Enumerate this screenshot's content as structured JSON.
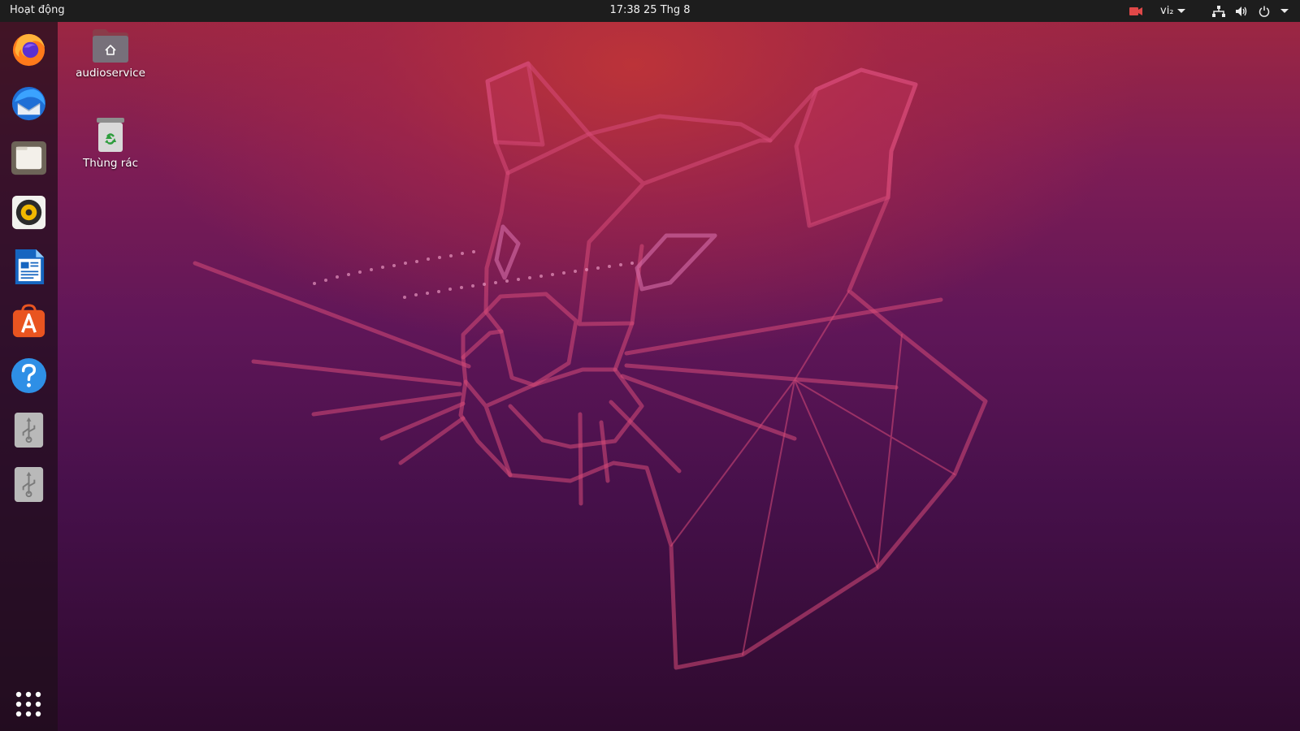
{
  "top_bar": {
    "activities_label": "Hoạt động",
    "clock_text": "17:38  25 Thg 8",
    "input_method_label": "vi₂",
    "tray_icons": [
      "screen-record-icon",
      "input-method-indicator",
      "network-icon",
      "volume-icon",
      "power-icon"
    ]
  },
  "dock": {
    "items": [
      {
        "name": "Firefox",
        "icon": "firefox-icon"
      },
      {
        "name": "Thunderbird",
        "icon": "thunderbird-icon"
      },
      {
        "name": "Files",
        "icon": "files-icon"
      },
      {
        "name": "Rhythmbox",
        "icon": "rhythmbox-icon"
      },
      {
        "name": "LibreOffice Writer",
        "icon": "libreoffice-writer-icon"
      },
      {
        "name": "Ubuntu Software",
        "icon": "ubuntu-software-icon"
      },
      {
        "name": "Help",
        "icon": "help-icon"
      },
      {
        "name": "USB Drive",
        "icon": "usb-drive-icon"
      },
      {
        "name": "USB Drive",
        "icon": "usb-drive-icon"
      }
    ],
    "show_apps_icon": "show-applications-grid-icon"
  },
  "desktop": {
    "icons": [
      {
        "label": "audioservice",
        "icon": "home-folder-icon"
      },
      {
        "label": "Thùng rác",
        "icon": "trash-icon"
      }
    ]
  },
  "colors": {
    "top_bar_bg": "#1d1d1d",
    "wallpaper_top": "#a1283f",
    "wallpaper_bottom": "#2e0a2e",
    "accent_orange": "#e95420"
  }
}
